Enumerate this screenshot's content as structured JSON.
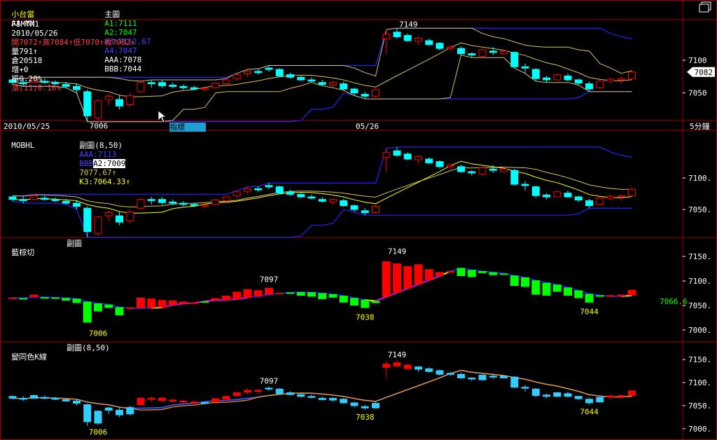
{
  "header": {
    "product": "小台當",
    "product_code": "AA-MM",
    "main_label": "主圖",
    "a1": "A1:7111",
    "a2": "A2:7047",
    "a3": "A3:7112.67",
    "a4": "A4:7047",
    "aaa": "AAA:7078",
    "bbb": "BBB:7044",
    "symbol": "FIMTX1",
    "date": "2010/05/26",
    "open": "開7072↑",
    "high": "高7084↑",
    "low": "低7070↑",
    "close": "收7082↑",
    "volume": "量791↑",
    "oi": "倉20518",
    "oi_change": "增+0",
    "amplitude": "振0.20%",
    "change": "漲(11)0.16%"
  },
  "colors": {
    "up": "#ff0000",
    "down": "#00ffff",
    "panel_border": "#a00000",
    "channel": "#2222ee",
    "band": "#d8c060",
    "ma_yellow": "#ffff00",
    "magenta": "#ff00ff",
    "axis_text": "#ffffff"
  },
  "icons": {
    "window": "window-icon"
  },
  "cursor": {
    "name": "mouse-pointer-icon"
  },
  "time_axis": {
    "date1": "2010/05/25",
    "date2": "05/26",
    "period": "5分鐘"
  },
  "panel2": {
    "name": "MOBHL",
    "sub_label": "副圖(8,50)",
    "aaa": "AAA:7113",
    "bbb": "BBB",
    "a2": "A2:7009",
    "k2": "7077.67↑",
    "k3": "K3:7064.33↑",
    "tooltip": "指標"
  },
  "panel3": {
    "name": "藍棕切",
    "sub_label": "副圖",
    "last_value": "7066.6"
  },
  "panel4": {
    "name": "變同色K線",
    "sub_label": "副圖(8,50)"
  },
  "chart_data": [
    {
      "panel": "main",
      "type": "candlestick",
      "ylim": [
        7010,
        7160
      ],
      "yticks": [
        "7100",
        "7050"
      ],
      "last_price": "7082",
      "candles": [
        [
          7070,
          7072,
          7063,
          7066
        ],
        [
          7066,
          7071,
          7060,
          7064
        ],
        [
          7066,
          7074,
          7065,
          7072
        ],
        [
          7068,
          7072,
          7064,
          7066
        ],
        [
          7066,
          7069,
          7062,
          7064
        ],
        [
          7063,
          7067,
          7058,
          7060
        ],
        [
          7060,
          7065,
          7050,
          7055
        ],
        [
          7052,
          7055,
          7006,
          7015
        ],
        [
          7012,
          7040,
          7008,
          7038
        ],
        [
          7040,
          7048,
          7032,
          7045
        ],
        [
          7040,
          7046,
          7025,
          7030
        ],
        [
          7032,
          7050,
          7028,
          7046
        ],
        [
          7052,
          7068,
          7050,
          7066
        ],
        [
          7066,
          7070,
          7058,
          7064
        ],
        [
          7066,
          7070,
          7058,
          7061
        ],
        [
          7062,
          7066,
          7057,
          7060
        ],
        [
          7060,
          7063,
          7055,
          7058
        ],
        [
          7058,
          7061,
          7054,
          7056
        ],
        [
          7056,
          7059,
          7052,
          7057
        ],
        [
          7058,
          7066,
          7057,
          7065
        ],
        [
          7064,
          7072,
          7061,
          7070
        ],
        [
          7072,
          7080,
          7068,
          7078
        ],
        [
          7079,
          7086,
          7075,
          7083
        ],
        [
          7083,
          7087,
          7078,
          7081
        ],
        [
          7088,
          7092,
          7082,
          7086
        ],
        [
          7086,
          7088,
          7074,
          7076
        ],
        [
          7078,
          7081,
          7072,
          7074
        ],
        [
          7074,
          7076,
          7068,
          7070
        ],
        [
          7070,
          7074,
          7066,
          7068
        ],
        [
          7066,
          7070,
          7061,
          7063
        ],
        [
          7062,
          7068,
          7058,
          7066
        ],
        [
          7064,
          7067,
          7054,
          7056
        ],
        [
          7056,
          7058,
          7046,
          7050
        ],
        [
          7048,
          7052,
          7041,
          7045
        ],
        [
          7045,
          7057,
          7043,
          7055
        ],
        [
          7133,
          7147,
          7110,
          7140
        ],
        [
          7143,
          7149,
          7133,
          7136
        ],
        [
          7138,
          7141,
          7128,
          7130
        ],
        [
          7129,
          7136,
          7123,
          7134
        ],
        [
          7130,
          7133,
          7122,
          7124
        ],
        [
          7126,
          7128,
          7115,
          7118
        ],
        [
          7118,
          7123,
          7114,
          7120
        ],
        [
          7118,
          7121,
          7108,
          7110
        ],
        [
          7110,
          7112,
          7104,
          7108
        ],
        [
          7106,
          7118,
          7104,
          7116
        ],
        [
          7114,
          7120,
          7108,
          7112
        ],
        [
          7110,
          7116,
          7109,
          7114
        ],
        [
          7112,
          7114,
          7088,
          7090
        ],
        [
          7090,
          7095,
          7080,
          7088
        ],
        [
          7086,
          7088,
          7068,
          7072
        ],
        [
          7073,
          7076,
          7066,
          7070
        ],
        [
          7070,
          7080,
          7069,
          7078
        ],
        [
          7076,
          7080,
          7068,
          7070
        ],
        [
          7070,
          7072,
          7062,
          7065
        ],
        [
          7064,
          7067,
          7052,
          7056
        ],
        [
          7058,
          7070,
          7056,
          7068
        ],
        [
          7068,
          7074,
          7064,
          7071
        ],
        [
          7070,
          7074,
          7064,
          7072
        ],
        [
          7072,
          7084,
          7070,
          7082
        ]
      ],
      "labels": [
        {
          "text": "7006",
          "index": 7
        },
        {
          "text": "7149",
          "index": 36
        }
      ]
    },
    {
      "panel": "MOBHL",
      "type": "candlestick",
      "ylim": [
        7010,
        7160
      ],
      "yticks": [
        "7100.",
        "7050."
      ]
    },
    {
      "panel": "藍棕切",
      "type": "line",
      "ylim": [
        6980,
        7170
      ],
      "yticks": [
        "7150.",
        "7100.",
        "7050.",
        "7000."
      ],
      "labels": [
        {
          "text": "7006",
          "index": 8
        },
        {
          "text": "7097",
          "index": 24
        },
        {
          "text": "7149",
          "index": 36
        },
        {
          "text": "7038",
          "index": 33
        },
        {
          "text": "7044",
          "index": 54
        }
      ]
    },
    {
      "panel": "變同色K線",
      "type": "candlestick",
      "ylim": [
        6980,
        7170
      ],
      "yticks": [
        "7150.",
        "7100.",
        "7050.",
        "7000."
      ],
      "labels": [
        {
          "text": "7006",
          "index": 8
        },
        {
          "text": "7097",
          "index": 24
        },
        {
          "text": "7149",
          "index": 36
        },
        {
          "text": "7038",
          "index": 33
        },
        {
          "text": "7044",
          "index": 54
        }
      ]
    }
  ]
}
